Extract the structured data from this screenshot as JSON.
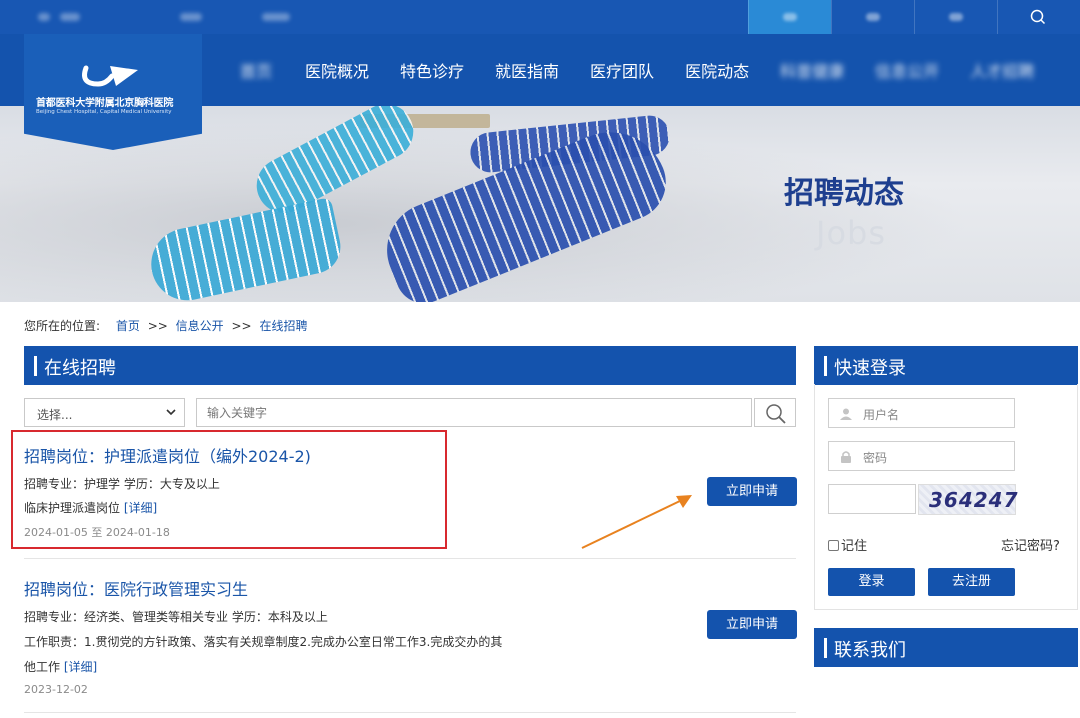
{
  "topbar": {
    "colors": {
      "bg": "#1857b3",
      "active_cell": "#2a8ad6"
    },
    "icons": [
      "search-icon"
    ]
  },
  "nav": {
    "logo": {
      "name_cn": "首都医科大学附属北京胸科医院",
      "name_en": "Beijing Chest Hospital, Capital Medical University"
    },
    "items": [
      "",
      "医院概况",
      "特色诊疗",
      "就医指南",
      "医疗团队",
      "医院动态",
      "",
      "",
      ""
    ]
  },
  "banner": {
    "title": "招聘动态",
    "subtitle": "Jobs"
  },
  "breadcrumb": {
    "label": "您所在的位置:",
    "items": [
      "首页",
      "信息公开",
      "在线招聘"
    ],
    "separator": ">>"
  },
  "main": {
    "section_title": "在线招聘",
    "filter": {
      "select_value": "选择...",
      "keyword_placeholder": "输入关键字"
    },
    "jobs": [
      {
        "title": "招聘岗位：护理派遣岗位（编外2024-2)",
        "major_line": "招聘专业：护理学    学历：大专及以上",
        "desc": "临床护理派遣岗位 ",
        "detail_link": "[详细]",
        "date": "2024-01-05 至 2024-01-18",
        "apply_label": "立即申请",
        "highlighted": true
      },
      {
        "title": "招聘岗位：医院行政管理实习生",
        "major_line": "招聘专业：经济类、管理类等相关专业    学历：本科及以上",
        "desc": "工作职责：1.贯彻党的方针政策、落实有关规章制度2.完成办公室日常工作3.完成交办的其",
        "desc2": "他工作 ",
        "detail_link": "[详细]",
        "date": "2023-12-02",
        "apply_label": "立即申请",
        "highlighted": false
      }
    ]
  },
  "sidebar": {
    "login_title": "快速登录",
    "username_placeholder": "用户名",
    "password_placeholder": "密码",
    "captcha_text": "364247",
    "remember_label": "记住",
    "forgot_label": "忘记密码?",
    "login_label": "登录",
    "register_label": "去注册",
    "contact_title": "联系我们"
  },
  "colors": {
    "brand_blue": "#1453ad",
    "link_blue": "#1a55a8",
    "highlight_red": "#d8292f",
    "arrow_orange": "#e8821f"
  }
}
